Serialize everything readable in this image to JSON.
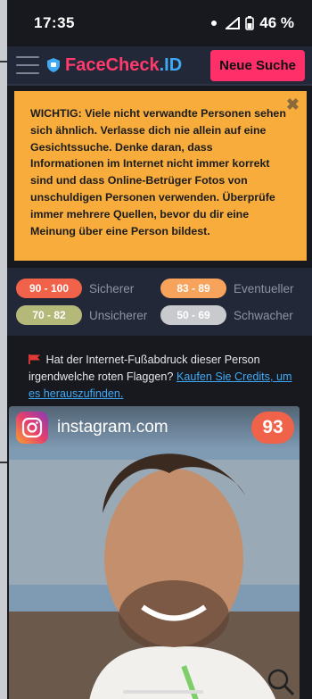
{
  "status": {
    "time": "17:35",
    "battery": "46 %"
  },
  "header": {
    "logo_face": "Face",
    "logo_check": "Check",
    "logo_id": ".ID",
    "new_search_label": "Neue Suche"
  },
  "warning": {
    "text": "WICHTIG: Viele nicht verwandte Personen sehen sich ähnlich. Verlasse dich nie allein auf eine Gesichtssuche. Denke daran, dass Informationen im Internet nicht immer korrekt sind und dass Online-Betrüger Fotos von unschuldigen Personen verwenden. Überprüfe immer mehrere Quellen, bevor du dir eine Meinung über eine Person bildest.",
    "close_glyph": "✖"
  },
  "legend": [
    {
      "range": "90 - 100",
      "label": "Sicherer",
      "color": "#f0624a"
    },
    {
      "range": "83 - 89",
      "label": "Eventueller",
      "color": "#f7a35c"
    },
    {
      "range": "70 - 82",
      "label": "Unsicherer",
      "color": "#b4b97a"
    },
    {
      "range": "50 - 69",
      "label": "Schwacher",
      "color": "#c8cacd"
    }
  ],
  "flags": {
    "text": "Hat der Internet-Fußabdruck dieser Person irgendwelche roten Flaggen?",
    "link": "Kaufen Sie Credits, um es herauszufinden."
  },
  "result": {
    "domain": "instagram.com",
    "score": "93"
  },
  "icons": {
    "flag": "red-flag-icon",
    "instagram": "instagram-icon",
    "search": "magnifier-icon",
    "menu": "hamburger-icon",
    "shield": "shield-icon"
  }
}
